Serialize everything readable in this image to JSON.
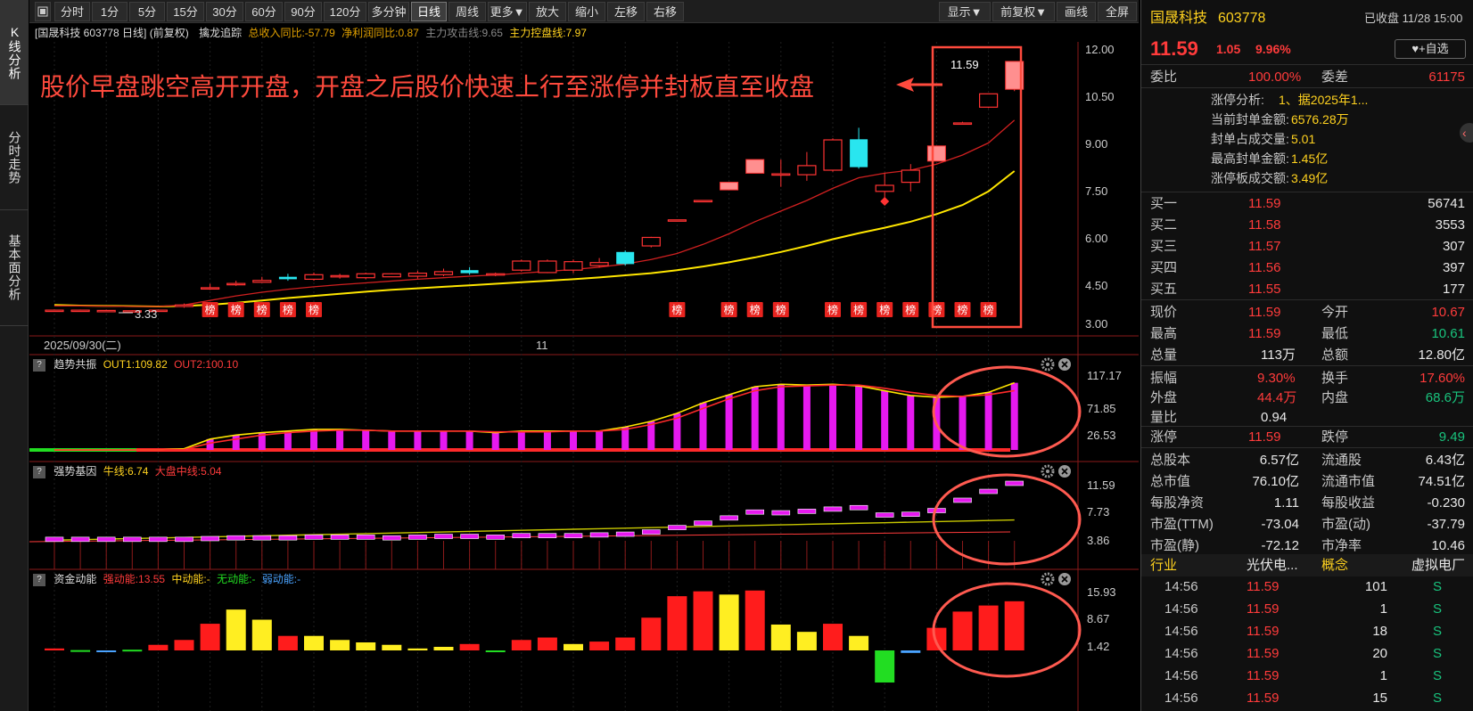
{
  "left_tabs": [
    "K线分析",
    "分时走势",
    "基本面分析"
  ],
  "toolbar": {
    "periods": [
      "分时",
      "1分",
      "5分",
      "15分",
      "30分",
      "60分",
      "90分",
      "120分",
      "多分钟",
      "日线",
      "周线",
      "更多▼"
    ],
    "actions": [
      "放大",
      "缩小",
      "左移",
      "右移"
    ],
    "right": [
      "显示▼",
      "前复权▼",
      "画线",
      "全屏"
    ],
    "active": "日线"
  },
  "main_panel": {
    "header": {
      "title": "[国晟科技 603778 日线]",
      "fq": "(前复权)",
      "indicator": "擒龙追踪",
      "rev": "总收入同比:-57.79",
      "profit": "净利润同比:0.87",
      "attack": "主力攻击线:9.65",
      "control": "主力控盘线:7.97"
    },
    "annotation": "股价早盘跳空高开开盘，开盘之后股价快速上行至涨停并封板直至收盘",
    "last_price_label": "11.59",
    "low_label": "3.33",
    "bang_label": "榜",
    "y_ticks": [
      "12.00",
      "10.50",
      "9.00",
      "7.50",
      "6.00",
      "4.50",
      "3.00"
    ],
    "date_label": "2025/09/30(二)",
    "month_label": "11"
  },
  "sub1": {
    "name": "趋势共振",
    "out1": "OUT1:109.82",
    "out2": "OUT2:100.10",
    "y_ticks": [
      "117.17",
      "71.85",
      "26.53"
    ]
  },
  "sub2": {
    "name": "强势基因",
    "bull": "牛线:6.74",
    "mid": "大盘中线:5.04",
    "y_ticks": [
      "11.59",
      "7.73",
      "3.86"
    ]
  },
  "sub3": {
    "name": "资金动能",
    "strong": "强动能:13.55",
    "mid": "中动能:-",
    "none": "无动能:-",
    "weak": "弱动能:-",
    "y_ticks": [
      "15.93",
      "8.67",
      "1.42"
    ]
  },
  "chart_data": {
    "type": "candlestick",
    "candles": [
      [
        3.38,
        3.4,
        3.36,
        3.38
      ],
      [
        3.38,
        3.4,
        3.35,
        3.37
      ],
      [
        3.37,
        3.39,
        3.35,
        3.36
      ],
      [
        3.36,
        3.38,
        3.34,
        3.36
      ],
      [
        3.36,
        3.4,
        3.33,
        3.38
      ],
      [
        3.5,
        3.6,
        3.46,
        3.55
      ],
      [
        4.12,
        4.25,
        4.05,
        4.12
      ],
      [
        4.22,
        4.35,
        4.18,
        4.26
      ],
      [
        4.36,
        4.48,
        4.28,
        4.3
      ],
      [
        4.4,
        4.58,
        4.35,
        4.48
      ],
      [
        4.4,
        4.62,
        4.35,
        4.55
      ],
      [
        4.48,
        4.58,
        4.42,
        4.52
      ],
      [
        4.45,
        4.62,
        4.4,
        4.58
      ],
      [
        4.58,
        4.5,
        4.6,
        4.48
      ],
      [
        4.5,
        4.68,
        4.42,
        4.6
      ],
      [
        4.55,
        4.75,
        4.5,
        4.65
      ],
      [
        4.6,
        4.8,
        4.55,
        4.7
      ],
      [
        4.55,
        4.62,
        4.5,
        4.58
      ],
      [
        4.7,
        5.05,
        4.65,
        5.0
      ],
      [
        5.0,
        5.05,
        4.6,
        4.62
      ],
      [
        4.7,
        5.05,
        4.6,
        4.98
      ],
      [
        4.85,
        5.1,
        4.78,
        4.95
      ],
      [
        4.9,
        5.35,
        4.85,
        5.3
      ],
      [
        5.5,
        5.8,
        5.45,
        5.78
      ],
      [
        6.36,
        6.36,
        6.36,
        6.36
      ],
      [
        7.0,
        7.0,
        6.98,
        7.0
      ],
      [
        7.35,
        7.6,
        7.35,
        7.6
      ],
      [
        7.9,
        8.35,
        7.9,
        8.35
      ],
      [
        7.85,
        8.35,
        7.45,
        7.88
      ],
      [
        7.85,
        8.6,
        7.65,
        8.15
      ],
      [
        8.0,
        9.05,
        7.95,
        9.0
      ],
      [
        9.02,
        9.4,
        8.05,
        8.1
      ],
      [
        7.5,
        7.9,
        6.9,
        7.3
      ],
      [
        7.6,
        8.2,
        7.3,
        8.0
      ],
      [
        8.3,
        8.8,
        8.3,
        8.8
      ],
      [
        9.55,
        9.6,
        9.5,
        9.56
      ],
      [
        10.08,
        10.52,
        10.05,
        10.52
      ],
      [
        10.67,
        11.59,
        10.61,
        11.59
      ]
    ],
    "ma_short": [
      3.52,
      3.52,
      3.51,
      3.5,
      3.5,
      3.55,
      3.7,
      3.85,
      3.97,
      4.07,
      4.15,
      4.22,
      4.28,
      4.34,
      4.4,
      4.45,
      4.5,
      4.54,
      4.6,
      4.66,
      4.72,
      4.8,
      4.9,
      5.05,
      5.25,
      5.55,
      5.9,
      6.3,
      6.65,
      7.0,
      7.4,
      7.75,
      7.9,
      8.0,
      8.2,
      8.5,
      8.9,
      9.65
    ],
    "ma_long": [
      3.55,
      3.53,
      3.52,
      3.51,
      3.5,
      3.52,
      3.56,
      3.62,
      3.7,
      3.78,
      3.85,
      3.92,
      3.99,
      4.05,
      4.1,
      4.15,
      4.2,
      4.25,
      4.3,
      4.35,
      4.4,
      4.46,
      4.53,
      4.6,
      4.7,
      4.82,
      4.96,
      5.12,
      5.3,
      5.5,
      5.72,
      5.92,
      6.1,
      6.3,
      6.55,
      6.85,
      7.3,
      7.97
    ],
    "bang_idx": [
      6,
      7,
      8,
      9,
      10,
      24,
      26,
      27,
      28,
      30,
      31,
      32,
      33,
      34,
      35,
      36
    ],
    "sub1_bars": [
      26.5,
      26.5,
      26.5,
      26.5,
      26.5,
      28,
      40,
      45,
      48,
      50,
      52,
      52,
      51,
      50,
      50,
      50,
      50,
      48,
      50,
      50,
      50,
      50,
      55,
      62,
      72,
      85,
      95,
      105,
      108,
      107,
      108,
      106,
      100,
      94,
      92,
      93,
      98,
      109.82
    ],
    "sub1_out2": [
      26.5,
      26.5,
      26.5,
      26.5,
      26.5,
      27,
      35,
      40,
      45,
      48,
      50,
      51,
      51,
      50,
      50,
      50,
      50,
      49,
      49,
      49,
      50,
      50,
      52,
      58,
      66,
      78,
      90,
      100,
      105,
      106,
      107,
      107,
      103,
      98,
      94,
      93,
      95,
      100.1
    ],
    "sub2_vals": [
      4.0,
      4.0,
      4.0,
      4.0,
      4.0,
      4.0,
      4.1,
      4.2,
      4.2,
      4.2,
      4.3,
      4.3,
      4.3,
      4.2,
      4.3,
      4.4,
      4.4,
      4.3,
      4.5,
      4.5,
      4.5,
      4.6,
      4.7,
      5.0,
      5.6,
      6.2,
      6.9,
      7.7,
      7.6,
      7.8,
      8.1,
      8.3,
      7.3,
      7.4,
      7.9,
      9.3,
      10.5,
      11.59
    ],
    "sub3_vals": [
      1.9,
      1.5,
      1.4,
      1.6,
      2.8,
      4.0,
      8.0,
      11.5,
      9.0,
      5.0,
      5.0,
      4.0,
      3.4,
      2.8,
      1.9,
      2.3,
      3.0,
      1.0,
      4.0,
      4.6,
      3.0,
      3.6,
      4.6,
      9.5,
      14.8,
      16.0,
      15.2,
      16.2,
      7.8,
      6.0,
      8.0,
      5.0,
      -6.5,
      0.8,
      7.0,
      11.0,
      12.5,
      13.55
    ],
    "sub3_colors": [
      "r",
      "g",
      "b",
      "g",
      "r",
      "r",
      "r",
      "y",
      "y",
      "r",
      "y",
      "y",
      "y",
      "y",
      "y",
      "y",
      "r",
      "g",
      "r",
      "r",
      "y",
      "r",
      "r",
      "r",
      "r",
      "r",
      "y",
      "r",
      "y",
      "y",
      "r",
      "y",
      "g",
      "b",
      "r",
      "r",
      "r",
      "r"
    ]
  },
  "quote": {
    "name": "国晟科技",
    "code": "603778",
    "status": "已收盘 11/28 15:00",
    "price": "11.59",
    "change": "1.05",
    "pct": "9.96%",
    "add_label": "+自选",
    "weibi_label": "委比",
    "weibi": "100.00%",
    "weicha_label": "委差",
    "weicha": "61175",
    "limit_info": [
      [
        "涨停分析:",
        "1、据2025年1..."
      ],
      [
        "当前封单金额:",
        "6576.28万"
      ],
      [
        "封单占成交量:",
        "5.01"
      ],
      [
        "最高封单金额:",
        "1.45亿"
      ],
      [
        "涨停板成交额:",
        "3.49亿"
      ]
    ],
    "bids": [
      [
        "买一",
        "11.59",
        "56741"
      ],
      [
        "买二",
        "11.58",
        "3553"
      ],
      [
        "买三",
        "11.57",
        "307"
      ],
      [
        "买四",
        "11.56",
        "397"
      ],
      [
        "买五",
        "11.55",
        "177"
      ]
    ],
    "stats1": [
      [
        "现价",
        "11.59",
        "今开",
        "10.67"
      ],
      [
        "最高",
        "11.59",
        "最低",
        "10.61"
      ],
      [
        "总量",
        "113万",
        "总额",
        "12.80亿"
      ]
    ],
    "stats2": [
      [
        "振幅",
        "9.30%",
        "换手",
        "17.60%"
      ],
      [
        "外盘",
        "44.4万",
        "内盘",
        "68.6万"
      ],
      [
        "量比",
        "0.94",
        "",
        ""
      ]
    ],
    "limits": [
      "涨停",
      "11.59",
      "跌停",
      "9.49"
    ],
    "fund": [
      [
        "总股本",
        "6.57亿",
        "流通股",
        "6.43亿"
      ],
      [
        "总市值",
        "76.10亿",
        "流通市值",
        "74.51亿"
      ],
      [
        "每股净资",
        "1.11",
        "每股收益",
        "-0.230"
      ],
      [
        "市盈(TTM)",
        "-73.04",
        "市盈(动)",
        "-37.79"
      ],
      [
        "市盈(静)",
        "-72.12",
        "市净率",
        "10.46"
      ]
    ],
    "industry": [
      "行业",
      "光伏电...",
      "概念",
      "虚拟电厂"
    ],
    "ticks": [
      [
        "14:56",
        "11.59",
        "101",
        "S"
      ],
      [
        "14:56",
        "11.59",
        "1",
        "S"
      ],
      [
        "14:56",
        "11.59",
        "18",
        "S"
      ],
      [
        "14:56",
        "11.59",
        "20",
        "S"
      ],
      [
        "14:56",
        "11.59",
        "1",
        "S"
      ],
      [
        "14:56",
        "11.59",
        "15",
        "S"
      ]
    ],
    "colors": {
      "up": "#ff3b3b",
      "down": "#19c37d",
      "accent": "#ffd21f"
    }
  }
}
